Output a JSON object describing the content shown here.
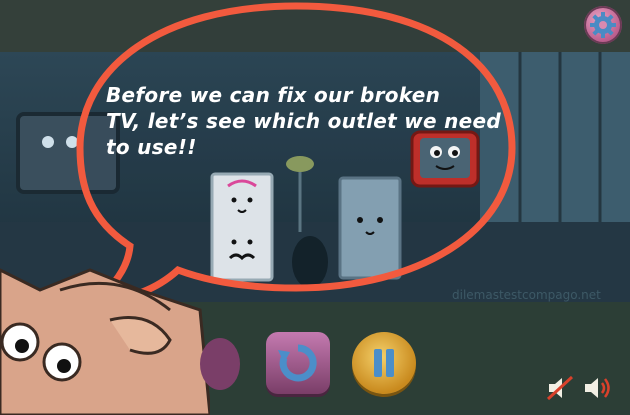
{
  "dialog": {
    "line1": "Before we can fix our broken",
    "line2": "TV, let’s see which outlet we need",
    "line3": "to use!!"
  },
  "watermark": "dilemastestcompago.net",
  "icons": {
    "settings": "gear-icon",
    "restart": "restart-icon",
    "pause": "pause-icon",
    "mute": "speaker-muted-icon",
    "sound": "speaker-sound-icon"
  },
  "colors": {
    "bubble_stroke": "#f25a3e",
    "pause_button": "#e0a83a",
    "restart_button": "#a45a8c",
    "tv_red": "#c8302a"
  }
}
